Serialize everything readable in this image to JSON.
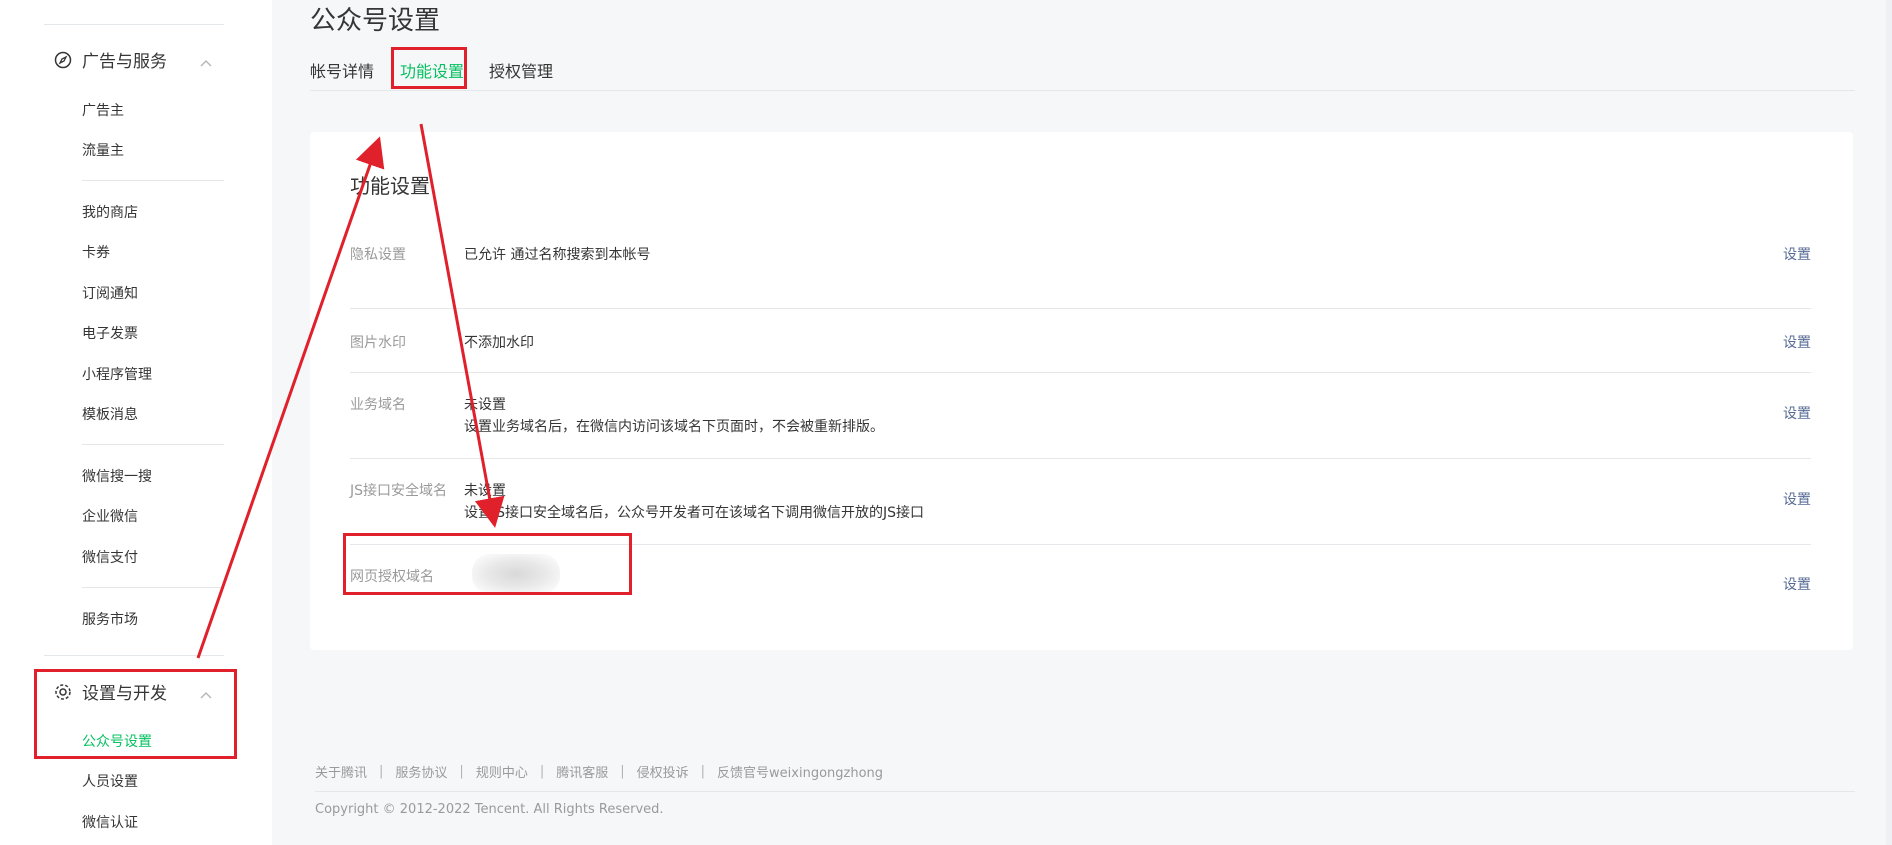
{
  "sidebar": {
    "group_ads": {
      "label": "广告与服务",
      "icon": "compass-icon"
    },
    "ads_items": [
      "广告主",
      "流量主"
    ],
    "feature_items": [
      "我的商店",
      "卡券",
      "订阅通知",
      "电子发票",
      "小程序管理",
      "模板消息"
    ],
    "wechat_items": [
      "微信搜一搜",
      "企业微信",
      "微信支付"
    ],
    "market_items": [
      "服务市场"
    ],
    "group_settings": {
      "label": "设置与开发",
      "icon": "gear-icon"
    },
    "settings_items": [
      "公众号设置",
      "人员设置",
      "微信认证"
    ],
    "active_item": "公众号设置"
  },
  "header": {
    "title": "公众号设置",
    "tabs": [
      "帐号详情",
      "功能设置",
      "授权管理"
    ],
    "active_tab": "功能设置"
  },
  "card": {
    "title": "功能设置",
    "rows": [
      {
        "label": "隐私设置",
        "value": "已允许 通过名称搜索到本帐号",
        "desc": "",
        "action": "设置"
      },
      {
        "label": "图片水印",
        "value": "不添加水印",
        "desc": "",
        "action": "设置"
      },
      {
        "label": "业务域名",
        "value": "未设置",
        "desc": "设置业务域名后，在微信内访问该域名下页面时，不会被重新排版。",
        "action": "设置"
      },
      {
        "label": "JS接口安全域名",
        "value": "未设置",
        "desc": "设置JS接口安全域名后，公众号开发者可在该域名下调用微信开放的JS接口",
        "action": "设置"
      },
      {
        "label": "网页授权域名",
        "value": "",
        "desc": "",
        "action": "设置"
      }
    ]
  },
  "footer": {
    "links": [
      "关于腾讯",
      "服务协议",
      "规则中心",
      "腾讯客服",
      "侵权投诉",
      "反馈官号weixingongzhong"
    ],
    "separator": "|",
    "copyright": "Copyright © 2012-2022 Tencent. All Rights Reserved."
  },
  "colors": {
    "accent": "#07c160",
    "link": "#576b95",
    "annotation": "#e0202a"
  }
}
